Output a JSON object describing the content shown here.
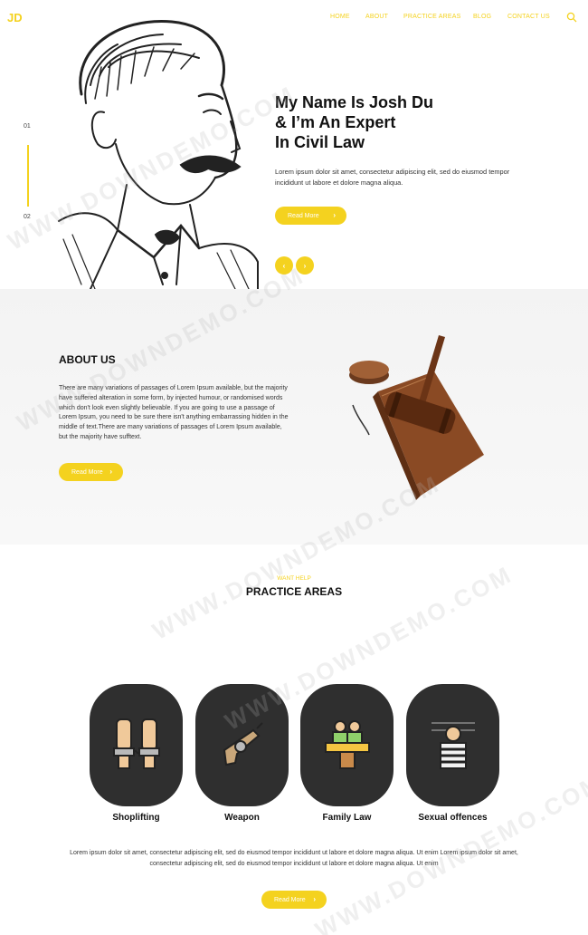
{
  "header": {
    "logo": "JD",
    "nav": [
      "HOME",
      "ABOUT",
      "PRACTICE AREAS",
      "BLOG",
      "CONTACT US"
    ]
  },
  "hero": {
    "slide_numbers": [
      "01",
      "02"
    ],
    "title_lines": [
      "My Name Is Josh Du",
      "& I’m An Expert",
      "In Civil Law"
    ],
    "text": "Lorem ipsum dolor sit amet, consectetur adipiscing elit, sed do eiusmod tempor incididunt ut labore et dolore magna aliqua.",
    "button": "Read More",
    "prev": "‹",
    "next": "›"
  },
  "about": {
    "title": "ABOUT US",
    "text": "There are many variations of passages of Lorem Ipsum available, but the majority have suffered alteration in some form, by injected humour, or randomised words which don't look even slightly believable. If you are going to use a passage of Lorem Ipsum, you need to be sure there isn't anything embarrassing hidden in the middle of text.There are many variations of passages of Lorem Ipsum available, but the majority have sufftext.",
    "button": "Read More"
  },
  "practice": {
    "subtitle": "WANT HELP",
    "title": "PRACTICE AREAS",
    "cards": [
      {
        "label": "Shoplifting",
        "icon": "handcuffs-icon"
      },
      {
        "label": "Weapon",
        "icon": "revolver-icon"
      },
      {
        "label": "Family Law",
        "icon": "courtroom-icon"
      },
      {
        "label": "Sexual offences",
        "icon": "prisoner-icon"
      }
    ],
    "text": "Lorem ipsum dolor sit amet, consectetur adipiscing elit, sed do eiusmod tempor incididunt ut labore et dolore magna aliqua. Ut enim Lorem ipsum dolor sit amet, consectetur adipiscing elit, sed do eiusmod tempor incididunt ut labore et dolore magna aliqua. Ut enim",
    "button": "Read More"
  },
  "watermark": "WWW.DOWNDEMO.COM",
  "colors": {
    "accent": "#f4d21f",
    "card_bg": "#2f2f2f"
  }
}
